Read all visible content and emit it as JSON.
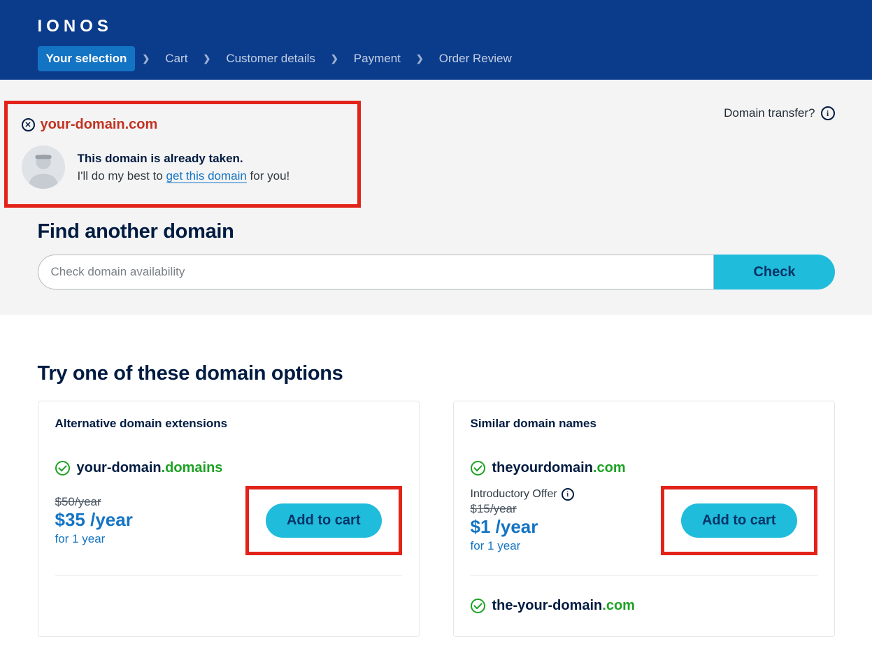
{
  "brand": "IONOS",
  "breadcrumb": [
    "Your selection",
    "Cart",
    "Customer details",
    "Payment",
    "Order Review"
  ],
  "active_crumb_index": 0,
  "status": {
    "domain": "your-domain.com",
    "taken_heading": "This domain is already taken.",
    "taken_line_prefix": "I'll do my best to ",
    "taken_link": "get this domain",
    "taken_line_suffix": " for you!"
  },
  "transfer_label": "Domain transfer?",
  "find_heading": "Find another domain",
  "search_placeholder": "Check domain availability",
  "check_button": "Check",
  "options_heading": "Try one of these domain options",
  "col1": {
    "title": "Alternative domain extensions",
    "options": [
      {
        "base": "your-domain",
        "tld": ".domains",
        "strike": "$50/year",
        "price": "$35 /year",
        "term": "for 1 year",
        "cta": "Add to cart"
      }
    ]
  },
  "col2": {
    "title": "Similar domain names",
    "options": [
      {
        "base": "theyourdomain",
        "tld": ".com",
        "intro": "Introductory Offer",
        "strike": "$15/year",
        "price": "$1 /year",
        "term": "for 1 year",
        "cta": "Add to cart"
      },
      {
        "base": "the-your-domain",
        "tld": ".com"
      }
    ]
  }
}
